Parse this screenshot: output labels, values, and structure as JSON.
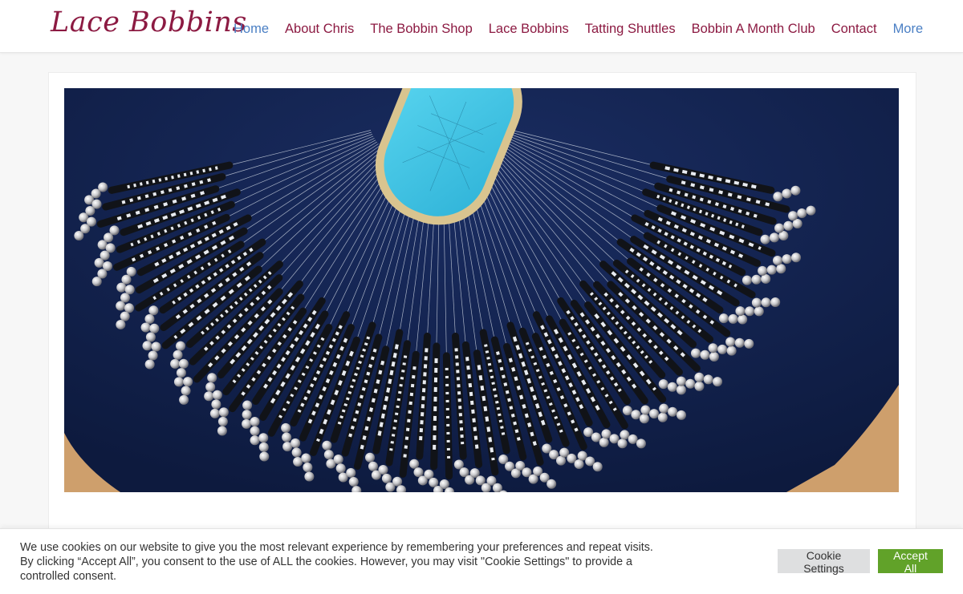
{
  "site": {
    "logo_text": "Lace Bobbins",
    "brand_color": "#8c1a42",
    "active_nav_color": "#4a7fc4"
  },
  "nav": {
    "items": [
      {
        "label": "Home",
        "active": true
      },
      {
        "label": "About Chris",
        "active": false
      },
      {
        "label": "The Bobbin Shop",
        "active": false
      },
      {
        "label": "Lace Bobbins",
        "active": false
      },
      {
        "label": "Tatting Shuttles",
        "active": false
      },
      {
        "label": "Bobbin A Month Club",
        "active": false
      },
      {
        "label": "Contact",
        "active": false
      },
      {
        "label": "More",
        "active": false
      }
    ]
  },
  "hero": {
    "image_alt": "Photo of many decorated lace bobbins with silver spangles arranged in a fan around a lace pillow",
    "colors": {
      "cloth": "#13234f",
      "floor": "#ce9f6c",
      "pricking": "#46c8e6"
    }
  },
  "cookie": {
    "message": "We use cookies on our website to give you the most relevant experience by remembering your preferences and repeat visits. By clicking “Accept All”, you consent to the use of ALL the cookies. However, you may visit \"Cookie Settings\" to provide a controlled consent.",
    "settings_label": "Cookie Settings",
    "accept_label": "Accept All",
    "accept_color": "#61a229"
  }
}
